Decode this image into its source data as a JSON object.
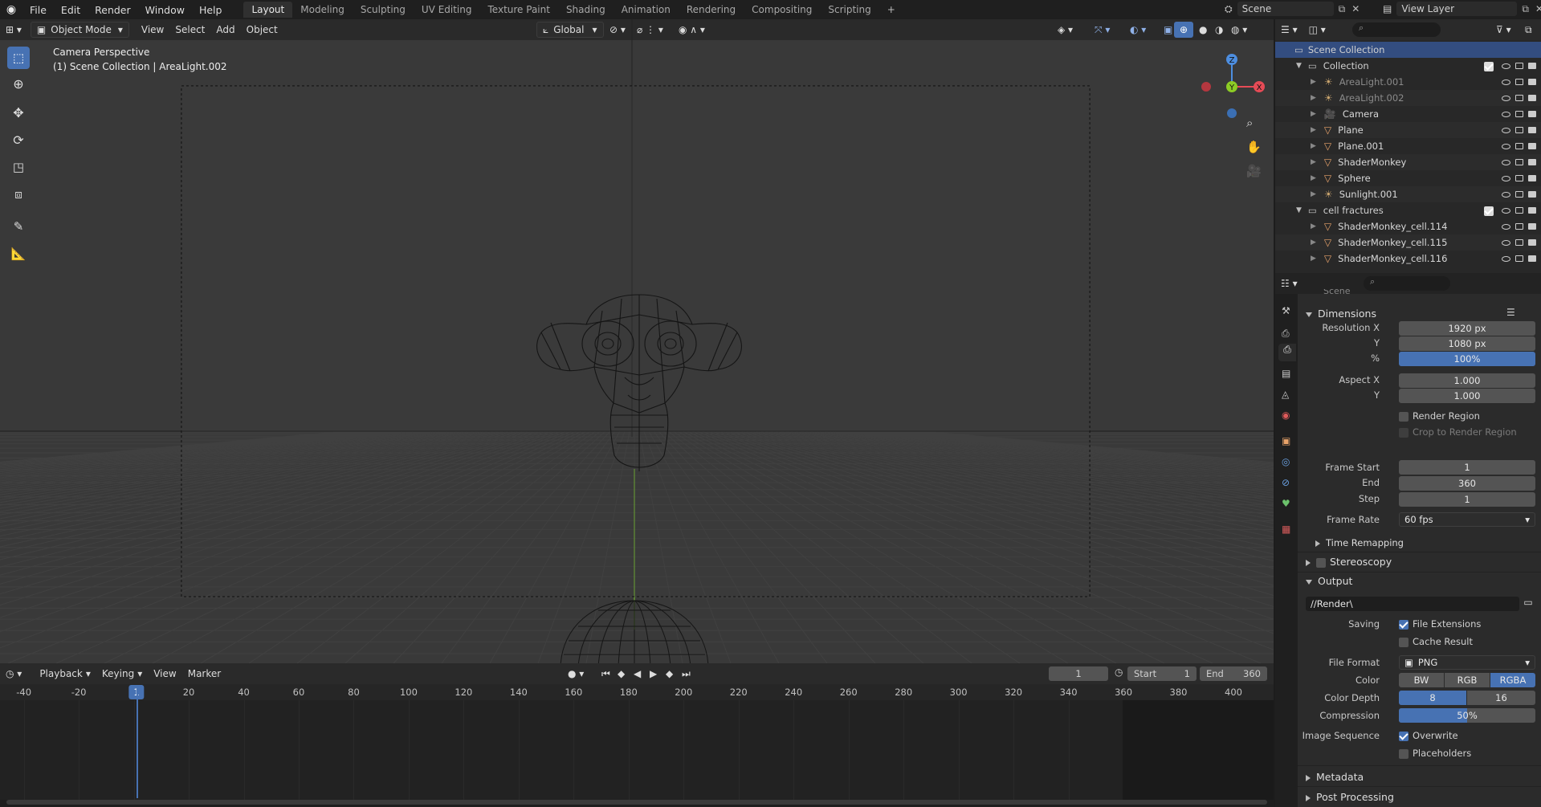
{
  "topbar": {
    "menus": [
      "File",
      "Edit",
      "Render",
      "Window",
      "Help"
    ],
    "workspaces": [
      "Layout",
      "Modeling",
      "Sculpting",
      "UV Editing",
      "Texture Paint",
      "Shading",
      "Animation",
      "Rendering",
      "Compositing",
      "Scripting"
    ],
    "active_workspace": "Layout",
    "add_workspace": "+",
    "scene_name": "Scene",
    "view_layer": "View Layer"
  },
  "viewport": {
    "mode": "Object Mode",
    "menus": [
      "View",
      "Select",
      "Add",
      "Object"
    ],
    "transform_orientation": "Global",
    "title": "Camera Perspective",
    "subtitle": "(1) Scene Collection | AreaLight.002",
    "gizmo": {
      "z": "Z",
      "y": "Y",
      "x": "X"
    }
  },
  "outliner": {
    "root": "Scene Collection",
    "collections": [
      {
        "name": "Collection",
        "items": [
          {
            "name": "AreaLight.001",
            "kind": "light",
            "dim": true
          },
          {
            "name": "AreaLight.002",
            "kind": "light",
            "dim": true
          },
          {
            "name": "Camera",
            "kind": "camera",
            "dim": false
          },
          {
            "name": "Plane",
            "kind": "mesh",
            "dim": false
          },
          {
            "name": "Plane.001",
            "kind": "mesh",
            "dim": false
          },
          {
            "name": "ShaderMonkey",
            "kind": "mesh",
            "dim": false
          },
          {
            "name": "Sphere",
            "kind": "mesh",
            "dim": false
          },
          {
            "name": "Sunlight.001",
            "kind": "light",
            "dim": false
          }
        ]
      },
      {
        "name": "cell fractures",
        "items": [
          {
            "name": "ShaderMonkey_cell.114",
            "kind": "mesh",
            "dim": false
          },
          {
            "name": "ShaderMonkey_cell.115",
            "kind": "mesh",
            "dim": false
          },
          {
            "name": "ShaderMonkey_cell.116",
            "kind": "mesh",
            "dim": false
          }
        ]
      }
    ]
  },
  "properties": {
    "context": "Scene",
    "dimensions": {
      "title": "Dimensions",
      "resolution_x_label": "Resolution X",
      "resolution_x": "1920 px",
      "resolution_y_label": "Y",
      "resolution_y": "1080 px",
      "percent_label": "%",
      "percent": "100%",
      "aspect_x_label": "Aspect X",
      "aspect_x": "1.000",
      "aspect_y_label": "Y",
      "aspect_y": "1.000",
      "render_region": "Render Region",
      "crop_region": "Crop to Render Region",
      "frame_start_label": "Frame Start",
      "frame_start": "1",
      "end_label": "End",
      "end": "360",
      "step_label": "Step",
      "step": "1",
      "frame_rate_label": "Frame Rate",
      "frame_rate": "60 fps",
      "time_remapping": "Time Remapping"
    },
    "stereoscopy": "Stereoscopy",
    "output": {
      "title": "Output",
      "path": "//Render\\",
      "saving_label": "Saving",
      "file_extensions": "File Extensions",
      "cache_result": "Cache Result",
      "file_format_label": "File Format",
      "file_format": "PNG",
      "color_label": "Color",
      "color_options": [
        "BW",
        "RGB",
        "RGBA"
      ],
      "color_selected": "RGBA",
      "color_depth_label": "Color Depth",
      "depth_options": [
        "8",
        "16"
      ],
      "depth_selected": "8",
      "compression_label": "Compression",
      "compression": "50%",
      "compression_value": 0.5,
      "image_sequence_label": "Image Sequence",
      "overwrite": "Overwrite",
      "placeholders": "Placeholders"
    },
    "metadata": "Metadata",
    "post_processing": "Post Processing"
  },
  "timeline": {
    "menus": [
      "Playback",
      "Keying",
      "View",
      "Marker"
    ],
    "current_frame": "1",
    "start_label": "Start",
    "start": "1",
    "end_label": "End",
    "end": "360",
    "ticks": [
      "-40",
      "-20",
      "1",
      "20",
      "40",
      "60",
      "80",
      "100",
      "120",
      "140",
      "160",
      "180",
      "200",
      "220",
      "240",
      "260",
      "280",
      "300",
      "320",
      "340",
      "360",
      "380",
      "400"
    ]
  },
  "colors": {
    "accent": "#4772b3",
    "mesh": "#e8a36a",
    "light": "#c9a46e",
    "x_axis": "#e64b56",
    "y_axis": "#8ccc25",
    "z_axis": "#4d8ee0"
  }
}
